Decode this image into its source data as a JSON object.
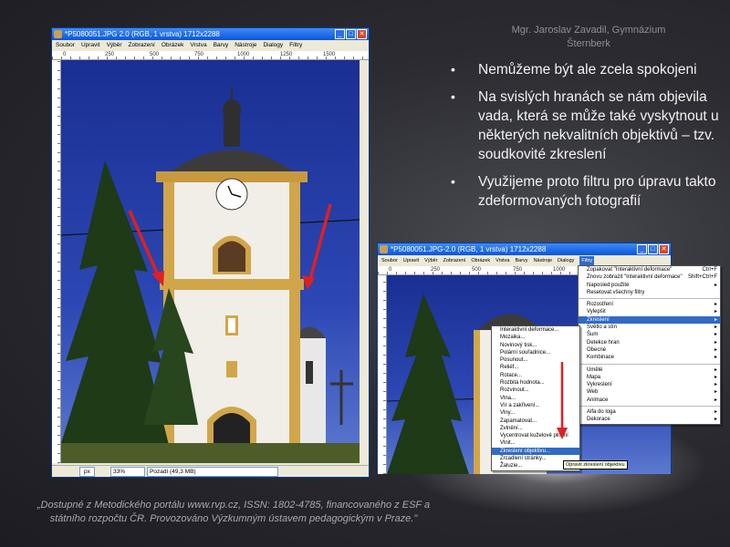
{
  "author": {
    "line1": "Mgr. Jaroslav Zavadil, Gymnázium",
    "line2": "Šternberk"
  },
  "bullets": [
    "Nemůžeme být ale zcela spokojeni",
    "Na svislých hranách se nám objevila vada, která se může také vyskytnout u některých nekvalitních objektivů – tzv. soudkovité zkreslení",
    "Využijeme proto filtru pro úpravu takto zdeformovaných fotografií"
  ],
  "footer": {
    "line1": "„Dostupné z Metodického portálu www.rvp.cz, ISSN: 1802-4785, financovaného z ESF a",
    "line2": "státního rozpočtu ČR. Provozováno Výzkumným ústavem pedagogickým v Praze.\""
  },
  "window1": {
    "title": "*P5080051.JPG 2.0 (RGB, 1 vrstva) 1712x2288",
    "menu": [
      "Soubor",
      "Upravit",
      "Výběr",
      "Zobrazení",
      "Obrázek",
      "Vrstva",
      "Barvy",
      "Nástroje",
      "Dialogy",
      "Filtry"
    ],
    "ruler": [
      "0",
      "250",
      "500",
      "750",
      "1000",
      "1250",
      "1500"
    ],
    "status": {
      "unit": "px",
      "zoom": "33%",
      "info": "Pozadí (49,3 MB)"
    }
  },
  "window2": {
    "title": "*P5080051.JPG-2.0 (RGB, 1 vrstva) 1712x2288",
    "menu": [
      "Soubor",
      "Upravit",
      "Výběr",
      "Zobrazení",
      "Obrázek",
      "Vrstva",
      "Barvy",
      "Nástroje",
      "Dialogy",
      "Filtry"
    ],
    "ruler": [
      "0",
      "250",
      "500",
      "750",
      "1000",
      "1250"
    ],
    "filters_menu": [
      {
        "label": "Zopakovat \"Interaktivní deformace\"",
        "shortcut": "Ctrl+F"
      },
      {
        "label": "Znovu zobrazit \"Interaktivní deformace\"",
        "shortcut": "Shift+Ctrl+F"
      },
      {
        "label": "Naposled použité",
        "arrow": true
      },
      {
        "label": "Resetovat všechny filtry"
      },
      {
        "sep": true
      },
      {
        "label": "Rozostření",
        "arrow": true
      },
      {
        "label": "Vylepšit",
        "arrow": true
      },
      {
        "label": "Zkreslení",
        "arrow": true,
        "highlight": true
      },
      {
        "label": "Světlo a stín",
        "arrow": true
      },
      {
        "label": "Šum",
        "arrow": true
      },
      {
        "label": "Detekce hran",
        "arrow": true
      },
      {
        "label": "Obecné",
        "arrow": true
      },
      {
        "label": "Kombinace",
        "arrow": true
      },
      {
        "sep": true
      },
      {
        "label": "Umělé",
        "arrow": true
      },
      {
        "label": "Mapa",
        "arrow": true
      },
      {
        "label": "Vykreslení",
        "arrow": true
      },
      {
        "label": "Web",
        "arrow": true
      },
      {
        "label": "Animace",
        "arrow": true
      },
      {
        "sep": true
      },
      {
        "label": "Alfa do loga",
        "arrow": true
      },
      {
        "label": "Dekorace",
        "arrow": true
      }
    ],
    "distort_submenu": [
      "Interaktivní deformace...",
      "Mozaika...",
      "Novinový tisk...",
      "Polární souřadnice...",
      "Posunout...",
      "Reliéf...",
      "Rotace...",
      "Rozbitá hodnota...",
      "Rozvinout...",
      "Vlna...",
      "Vír a zakřivení...",
      "Vlny...",
      "Zapamatovat...",
      "Zvlnění...",
      "Vycentrovat kuželové plnění",
      "Vlnit...",
      "Zkreslení objektivu...",
      "Zrcadlení stránky...",
      "Žaluzie..."
    ],
    "distort_highlight_index": 16,
    "tooltip": "Opravit zkreslení objektivu"
  },
  "accent": {
    "arrow": "#e02020",
    "titlebar": "#0c55d8",
    "menu_highlight": "#316ac5"
  }
}
